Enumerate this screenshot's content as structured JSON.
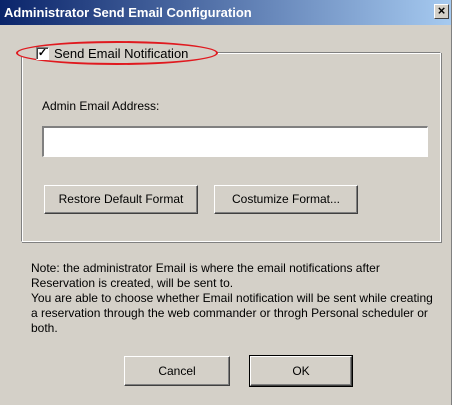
{
  "window": {
    "title": "Administrator Send Email Configuration",
    "close_label": "×"
  },
  "notification": {
    "checkbox_label": "Send Email Notification",
    "checked": true,
    "check_mark": "✓"
  },
  "email": {
    "label": "Admin Email Address:",
    "value": ""
  },
  "buttons": {
    "restore": "Restore Default Format",
    "customize": "Costumize Format...",
    "cancel": "Cancel",
    "ok": "OK"
  },
  "note": {
    "line1": "Note: the administrator Email is where the email notifications after Reservation is created, will be sent to.",
    "line2": "You are able to choose whether Email notification will be sent while creating a reservation through the web commander  or throgh Personal scheduler or both."
  },
  "colors": {
    "highlight_ellipse": "#e0191f",
    "titlebar_start": "#0a246a",
    "titlebar_end": "#a6caf0",
    "dialog_bg": "#d4d0c8"
  }
}
